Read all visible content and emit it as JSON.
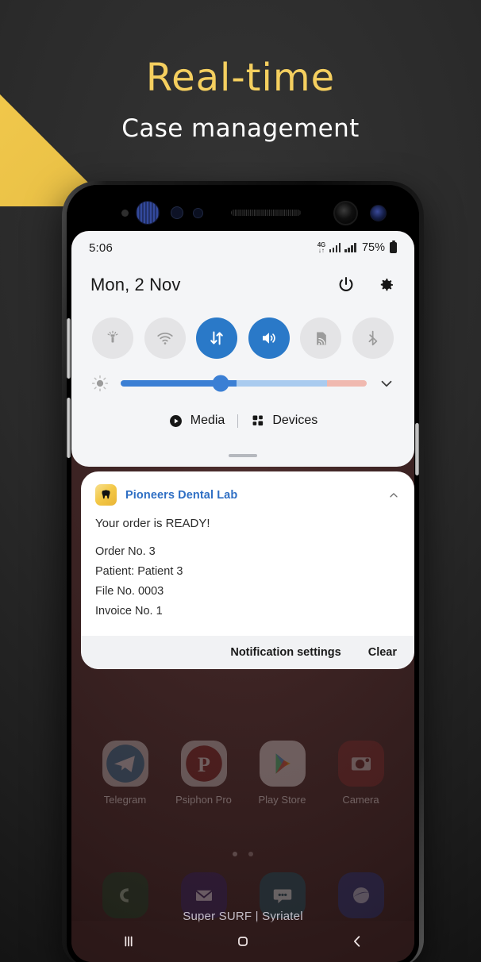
{
  "promo": {
    "heading": "Real-time",
    "subheading": "Case management",
    "gold_color": "#f2c94c",
    "heading_color": "#f5cf5f",
    "sub_color": "#ffffff"
  },
  "status_bar": {
    "time": "5:06",
    "network_type": "4G",
    "network_arrows": "↓↑",
    "battery_percent": "75%",
    "icons": [
      "4g-data-icon",
      "signal-bars-sim1-icon",
      "signal-bars-sim2-icon",
      "battery-icon"
    ]
  },
  "panel": {
    "date": "Mon, 2 Nov",
    "power_icon": "power-icon",
    "settings_icon": "gear-icon",
    "toggles": [
      {
        "name": "flashlight",
        "icon": "flashlight-icon",
        "active": false
      },
      {
        "name": "wifi",
        "icon": "wifi-icon",
        "active": false
      },
      {
        "name": "mobile-data",
        "icon": "data-transfer-icon",
        "active": true
      },
      {
        "name": "sound",
        "icon": "volume-icon",
        "active": true
      },
      {
        "name": "smart-view",
        "icon": "smart-view-icon",
        "active": false
      },
      {
        "name": "bluetooth",
        "icon": "bluetooth-icon",
        "active": false
      }
    ],
    "brightness": {
      "icon": "brightness-icon",
      "value_percent": 44,
      "expand_icon": "chevron-down-icon",
      "fill_color": "#3b7fd4",
      "mid_color": "#a9cbef",
      "warn_color": "#f0b9b0"
    },
    "media_label": "Media",
    "media_icon": "play-circle-icon",
    "devices_label": "Devices",
    "devices_icon": "grid-squares-icon",
    "handle": "drag-handle"
  },
  "notification": {
    "app_name": "Pioneers Dental Lab",
    "app_icon": "tooth-icon",
    "app_name_color": "#2f6fc4",
    "collapse_icon": "chevron-up-icon",
    "title": "Your order is READY!",
    "lines": [
      "Order No. 3",
      "Patient: Patient 3",
      "File No. 0003",
      "Invoice No. 1"
    ],
    "actions": [
      {
        "label": "Notification settings",
        "name": "notification-settings-button"
      },
      {
        "label": "Clear",
        "name": "clear-button"
      }
    ]
  },
  "home_screen": {
    "apps": [
      {
        "label": "Telegram",
        "icon": "telegram-icon",
        "color": "#2b7ba8"
      },
      {
        "label": "Psiphon Pro",
        "icon": "psiphon-icon",
        "color": "#7a1a1a"
      },
      {
        "label": "Play Store",
        "icon": "play-store-icon",
        "color": "#efefef"
      },
      {
        "label": "Camera",
        "icon": "camera-icon",
        "color": "#7d2626"
      }
    ],
    "page_dots": 2,
    "active_page": 1,
    "dock": [
      {
        "label": "Phone",
        "icon": "phone-icon",
        "color": "#13361f"
      },
      {
        "label": "Email",
        "icon": "email-icon",
        "color": "#2a1a52"
      },
      {
        "label": "Messages",
        "icon": "messages-icon",
        "color": "#154552"
      },
      {
        "label": "Internet",
        "icon": "internet-icon",
        "color": "#1f2a66"
      }
    ],
    "carrier_text": "Super SURF | Syriatel"
  },
  "navbar": {
    "recents_label": "recents",
    "recents_icon": "recents-icon",
    "home_label": "home",
    "home_icon": "home-icon",
    "back_label": "back",
    "back_icon": "back-icon"
  }
}
